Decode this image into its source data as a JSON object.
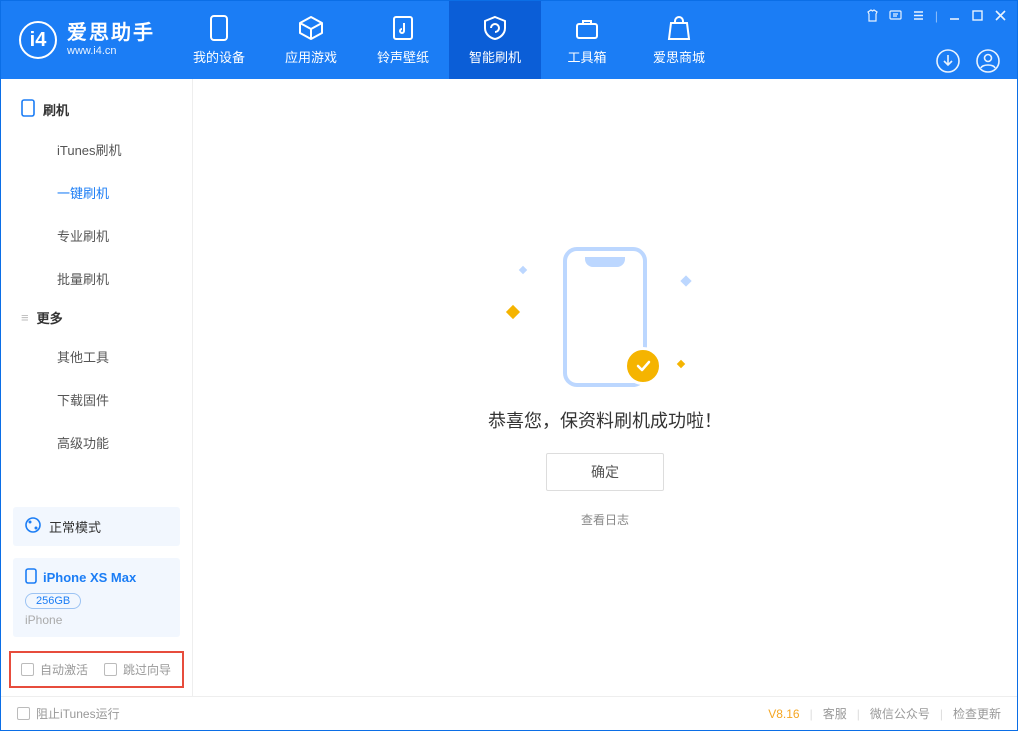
{
  "app": {
    "name": "爱思助手",
    "domain": "www.i4.cn"
  },
  "nav": {
    "tabs": [
      {
        "label": "我的设备"
      },
      {
        "label": "应用游戏"
      },
      {
        "label": "铃声壁纸"
      },
      {
        "label": "智能刷机"
      },
      {
        "label": "工具箱"
      },
      {
        "label": "爱思商城"
      }
    ],
    "active_index": 3
  },
  "sidebar": {
    "sections": [
      {
        "title": "刷机",
        "items": [
          "iTunes刷机",
          "一键刷机",
          "专业刷机",
          "批量刷机"
        ],
        "active_index": 1
      },
      {
        "title": "更多",
        "items": [
          "其他工具",
          "下载固件",
          "高级功能"
        ]
      }
    ],
    "mode_label": "正常模式",
    "device": {
      "name": "iPhone XS Max",
      "storage": "256GB",
      "type": "iPhone"
    },
    "options": {
      "auto_activate": "自动激活",
      "skip_guide": "跳过向导"
    }
  },
  "main": {
    "success_message": "恭喜您，保资料刷机成功啦！",
    "confirm_label": "确定",
    "view_log_label": "查看日志"
  },
  "footer": {
    "stop_itunes": "阻止iTunes运行",
    "version": "V8.16",
    "links": [
      "客服",
      "微信公众号",
      "检查更新"
    ]
  }
}
